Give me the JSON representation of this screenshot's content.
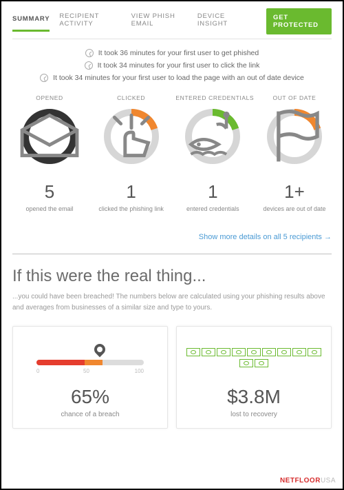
{
  "tabs": {
    "summary": "SUMMARY",
    "recipient": "RECIPIENT ACTIVITY",
    "view_email": "VIEW PHISH EMAIL",
    "device": "DEVICE INSIGHT",
    "cta": "GET PROTECTED"
  },
  "bullets": {
    "b1": "It took 36 minutes for your first user to get phished",
    "b2": "It took 34 minutes for your first user to click the link",
    "b3": "It took 34 minutes for your first user to load the page with an out of date device"
  },
  "stats": {
    "opened": {
      "label": "OPENED",
      "value": "5",
      "sub": "opened the email"
    },
    "clicked": {
      "label": "CLICKED",
      "value": "1",
      "sub": "clicked the phishing link"
    },
    "creds": {
      "label": "ENTERED CREDENTIALS",
      "value": "1",
      "sub": "entered credentials"
    },
    "outdate": {
      "label": "OUT OF DATE",
      "value": "1+",
      "sub": "devices are out of date"
    }
  },
  "showmore": "Show more details on all 5 recipients →",
  "headline": "If this were the real thing...",
  "blurb": "...you could have been breached! The numbers below are calculated using your phishing results above and averages from businesses of a similar size and type to yours.",
  "cards": {
    "breach": {
      "value": "65%",
      "sub": "chance of a breach"
    },
    "cost": {
      "value": "$3.8M",
      "sub": "lost to recovery"
    }
  },
  "footer": {
    "left": "NETFLOOR",
    "right": "USA"
  },
  "chart_data": [
    {
      "type": "pie",
      "title": "OPENED",
      "values": [
        100
      ],
      "colors": [
        "#333"
      ],
      "center_value": 5
    },
    {
      "type": "pie",
      "title": "CLICKED",
      "values": [
        20,
        80
      ],
      "colors": [
        "#f0872f",
        "#d6d6d6"
      ],
      "center_value": 1
    },
    {
      "type": "pie",
      "title": "ENTERED CREDENTIALS",
      "values": [
        20,
        80
      ],
      "colors": [
        "#6aba2f",
        "#d6d6d6"
      ],
      "center_value": 1
    },
    {
      "type": "pie",
      "title": "OUT OF DATE",
      "values": [
        20,
        80
      ],
      "colors": [
        "#f0872f",
        "#d6d6d6"
      ],
      "center_value": 1
    },
    {
      "type": "bar",
      "title": "chance of a breach",
      "xlabel": "",
      "ylabel": "",
      "categories": [
        "0",
        "50",
        "100"
      ],
      "values": [
        65
      ],
      "ylim": [
        0,
        100
      ]
    }
  ]
}
